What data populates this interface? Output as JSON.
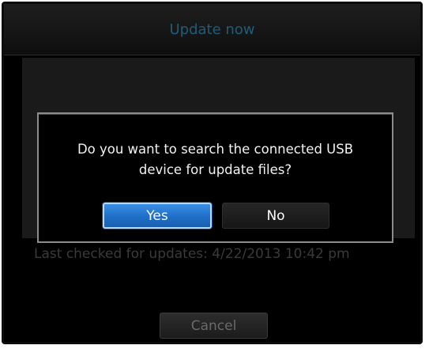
{
  "dialog": {
    "title": "Update now",
    "last_checked": "Last checked for updates: 4/22/2013 10:42 pm",
    "cancel_label": "Cancel"
  },
  "modal": {
    "message_line1": "Do you want to search the connected USB",
    "message_line2": "device for update files?",
    "yes_label": "Yes",
    "no_label": "No"
  },
  "colors": {
    "title_text": "#1f5c7a",
    "accent_selected": "#1e6ec8",
    "modal_border": "#8c8c8c"
  }
}
